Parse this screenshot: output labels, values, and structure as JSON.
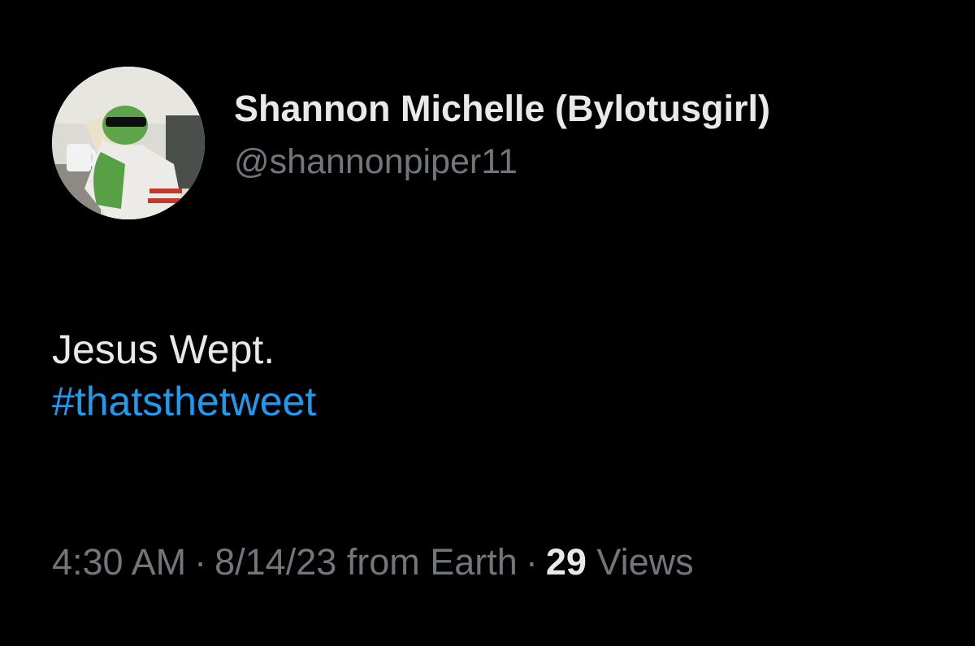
{
  "tweet": {
    "author": {
      "display_name": "Shannon Michelle (Bylotusgirl)",
      "handle": "@shannonpiper11",
      "avatar_icon": "avatar-image"
    },
    "text_line": "Jesus Wept.",
    "hashtag": "#thatsthetweet",
    "time": "4:30 AM",
    "separator": "·",
    "date": "8/14/23",
    "source": "from Earth",
    "views_count": "29",
    "views_label": "Views"
  },
  "colors": {
    "background": "#000000",
    "primary_text": "#e7e9ea",
    "secondary_text": "#71767b",
    "link": "#1d9bf0"
  }
}
